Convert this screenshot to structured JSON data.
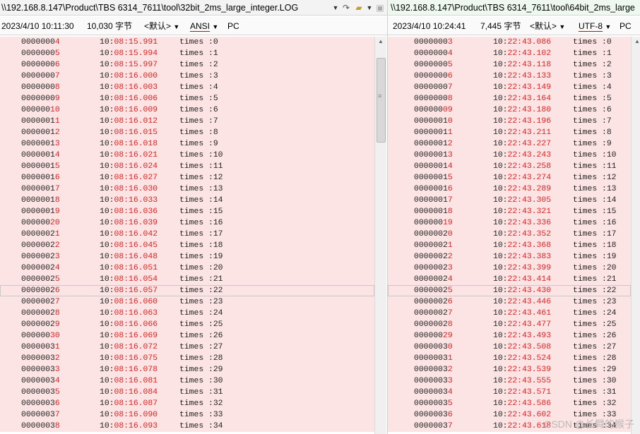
{
  "left": {
    "path": "\\\\192.168.8.147\\Product\\TBS 6314_7611\\tool\\32bit_2ms_large_integer.LOG",
    "date": "2023/4/10 10:11:30",
    "size": "10,030 字节",
    "lang": "<默认>",
    "encoding": "ANSI",
    "lineend": "PC",
    "rows": [
      {
        "n": "00000004",
        "t": "10:08:15.991",
        "x": "times :0"
      },
      {
        "n": "00000005",
        "t": "10:08:15.994",
        "x": "times :1"
      },
      {
        "n": "00000006",
        "t": "10:08:15.997",
        "x": "times :2"
      },
      {
        "n": "00000007",
        "t": "10:08:16.000",
        "x": "times :3"
      },
      {
        "n": "00000008",
        "t": "10:08:16.003",
        "x": "times :4"
      },
      {
        "n": "00000009",
        "t": "10:08:16.006",
        "x": "times :5"
      },
      {
        "n": "00000010",
        "t": "10:08:16.009",
        "x": "times :6"
      },
      {
        "n": "00000011",
        "t": "10:08:16.012",
        "x": "times :7"
      },
      {
        "n": "00000012",
        "t": "10:08:16.015",
        "x": "times :8"
      },
      {
        "n": "00000013",
        "t": "10:08:16.018",
        "x": "times :9"
      },
      {
        "n": "00000014",
        "t": "10:08:16.021",
        "x": "times :10"
      },
      {
        "n": "00000015",
        "t": "10:08:16.024",
        "x": "times :11"
      },
      {
        "n": "00000016",
        "t": "10:08:16.027",
        "x": "times :12"
      },
      {
        "n": "00000017",
        "t": "10:08:16.030",
        "x": "times :13"
      },
      {
        "n": "00000018",
        "t": "10:08:16.033",
        "x": "times :14"
      },
      {
        "n": "00000019",
        "t": "10:08:16.036",
        "x": "times :15"
      },
      {
        "n": "00000020",
        "t": "10:08:16.039",
        "x": "times :16"
      },
      {
        "n": "00000021",
        "t": "10:08:16.042",
        "x": "times :17"
      },
      {
        "n": "00000022",
        "t": "10:08:16.045",
        "x": "times :18"
      },
      {
        "n": "00000023",
        "t": "10:08:16.048",
        "x": "times :19"
      },
      {
        "n": "00000024",
        "t": "10:08:16.051",
        "x": "times :20"
      },
      {
        "n": "00000025",
        "t": "10:08:16.054",
        "x": "times :21"
      },
      {
        "n": "00000026",
        "t": "10:08:16.057",
        "x": "times :22"
      },
      {
        "n": "00000027",
        "t": "10:08:16.060",
        "x": "times :23"
      },
      {
        "n": "00000028",
        "t": "10:08:16.063",
        "x": "times :24"
      },
      {
        "n": "00000029",
        "t": "10:08:16.066",
        "x": "times :25"
      },
      {
        "n": "00000030",
        "t": "10:08:16.069",
        "x": "times :26"
      },
      {
        "n": "00000031",
        "t": "10:08:16.072",
        "x": "times :27"
      },
      {
        "n": "00000032",
        "t": "10:08:16.075",
        "x": "times :28"
      },
      {
        "n": "00000033",
        "t": "10:08:16.078",
        "x": "times :29"
      },
      {
        "n": "00000034",
        "t": "10:08:16.081",
        "x": "times :30"
      },
      {
        "n": "00000035",
        "t": "10:08:16.084",
        "x": "times :31"
      },
      {
        "n": "00000036",
        "t": "10:08:16.087",
        "x": "times :32"
      },
      {
        "n": "00000037",
        "t": "10:08:16.090",
        "x": "times :33"
      },
      {
        "n": "00000038",
        "t": "10:08:16.093",
        "x": "times :34"
      }
    ]
  },
  "right": {
    "path": "\\\\192.168.8.147\\Product\\TBS 6314_7611\\tool\\64bit_2ms_large",
    "date": "2023/4/10 10:24:41",
    "size": "7,445 字节",
    "lang": "<默认>",
    "encoding": "UTF-8",
    "lineend": "PC",
    "rows": [
      {
        "n": "00000003",
        "t": "10:22:43.086",
        "x": "times :0"
      },
      {
        "n": "00000004",
        "t": "10:22:43.102",
        "x": "times :1"
      },
      {
        "n": "00000005",
        "t": "10:22:43.118",
        "x": "times :2"
      },
      {
        "n": "00000006",
        "t": "10:22:43.133",
        "x": "times :3"
      },
      {
        "n": "00000007",
        "t": "10:22:43.149",
        "x": "times :4"
      },
      {
        "n": "00000008",
        "t": "10:22:43.164",
        "x": "times :5"
      },
      {
        "n": "00000009",
        "t": "10:22:43.180",
        "x": "times :6"
      },
      {
        "n": "00000010",
        "t": "10:22:43.196",
        "x": "times :7"
      },
      {
        "n": "00000011",
        "t": "10:22:43.211",
        "x": "times :8"
      },
      {
        "n": "00000012",
        "t": "10:22:43.227",
        "x": "times :9"
      },
      {
        "n": "00000013",
        "t": "10:22:43.243",
        "x": "times :10"
      },
      {
        "n": "00000014",
        "t": "10:22:43.258",
        "x": "times :11"
      },
      {
        "n": "00000015",
        "t": "10:22:43.274",
        "x": "times :12"
      },
      {
        "n": "00000016",
        "t": "10:22:43.289",
        "x": "times :13"
      },
      {
        "n": "00000017",
        "t": "10:22:43.305",
        "x": "times :14"
      },
      {
        "n": "00000018",
        "t": "10:22:43.321",
        "x": "times :15"
      },
      {
        "n": "00000019",
        "t": "10:22:43.336",
        "x": "times :16"
      },
      {
        "n": "00000020",
        "t": "10:22:43.352",
        "x": "times :17"
      },
      {
        "n": "00000021",
        "t": "10:22:43.368",
        "x": "times :18"
      },
      {
        "n": "00000022",
        "t": "10:22:43.383",
        "x": "times :19"
      },
      {
        "n": "00000023",
        "t": "10:22:43.399",
        "x": "times :20"
      },
      {
        "n": "00000024",
        "t": "10:22:43.414",
        "x": "times :21"
      },
      {
        "n": "00000025",
        "t": "10:22:43.430",
        "x": "times :22"
      },
      {
        "n": "00000026",
        "t": "10:22:43.446",
        "x": "times :23"
      },
      {
        "n": "00000027",
        "t": "10:22:43.461",
        "x": "times :24"
      },
      {
        "n": "00000028",
        "t": "10:22:43.477",
        "x": "times :25"
      },
      {
        "n": "00000029",
        "t": "10:22:43.493",
        "x": "times :26"
      },
      {
        "n": "00000030",
        "t": "10:22:43.508",
        "x": "times :27"
      },
      {
        "n": "00000031",
        "t": "10:22:43.524",
        "x": "times :28"
      },
      {
        "n": "00000032",
        "t": "10:22:43.539",
        "x": "times :29"
      },
      {
        "n": "00000033",
        "t": "10:22:43.555",
        "x": "times :30"
      },
      {
        "n": "00000034",
        "t": "10:22:43.571",
        "x": "times :31"
      },
      {
        "n": "00000035",
        "t": "10:22:43.586",
        "x": "times :32"
      },
      {
        "n": "00000036",
        "t": "10:22:43.602",
        "x": "times :33"
      },
      {
        "n": "00000037",
        "t": "10:22:43.618",
        "x": "times :34"
      }
    ]
  },
  "highlighted_row_index": 22,
  "watermark": "CSDN @长臂的猴子",
  "colors": {
    "row_bg": "#fde4e4",
    "diff_text": "#e02020",
    "accent": "#d00000"
  }
}
